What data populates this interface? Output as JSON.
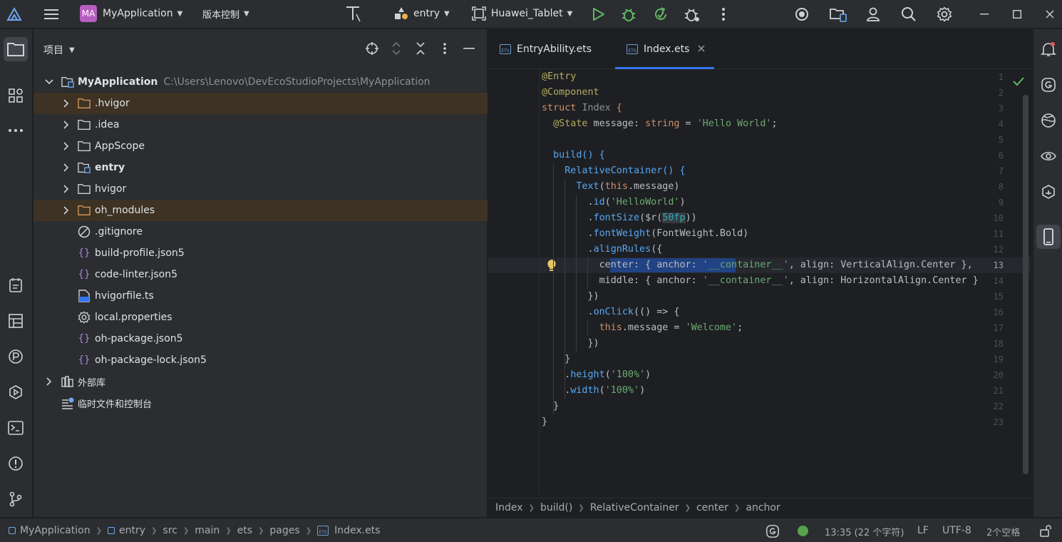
{
  "titlebar": {
    "project_badge": "MA",
    "project_name": "MyApplication",
    "vcs_label": "版本控制",
    "run_config": "entry",
    "device": "Huawei_Tablet"
  },
  "project_panel": {
    "title": "项目",
    "root_name": "MyApplication",
    "root_path": "C:\\Users\\Lenovo\\DevEcoStudioProjects\\MyApplication",
    "items": [
      {
        "label": ".hvigor",
        "kind": "folder-excluded"
      },
      {
        "label": ".idea",
        "kind": "folder"
      },
      {
        "label": "AppScope",
        "kind": "folder"
      },
      {
        "label": "entry",
        "kind": "module"
      },
      {
        "label": "hvigor",
        "kind": "folder"
      },
      {
        "label": "oh_modules",
        "kind": "folder-excluded"
      },
      {
        "label": ".gitignore",
        "kind": "ignore"
      },
      {
        "label": "build-profile.json5",
        "kind": "json"
      },
      {
        "label": "code-linter.json5",
        "kind": "json"
      },
      {
        "label": "hvigorfile.ts",
        "kind": "ts"
      },
      {
        "label": "local.properties",
        "kind": "properties"
      },
      {
        "label": "oh-package.json5",
        "kind": "json"
      },
      {
        "label": "oh-package-lock.json5",
        "kind": "json"
      }
    ],
    "external_libs": "外部库",
    "scratches": "临时文件和控制台"
  },
  "editor": {
    "tabs": [
      {
        "label": "EntryAbility.ets",
        "active": false
      },
      {
        "label": "Index.ets",
        "active": true
      }
    ],
    "file_icon_text": "ETS",
    "line_numbers": [
      "1",
      "2",
      "3",
      "4",
      "5",
      "6",
      "7",
      "8",
      "9",
      "10",
      "11",
      "12",
      "13",
      "14",
      "15",
      "16",
      "17",
      "18",
      "19",
      "20",
      "21",
      "22",
      "23"
    ],
    "current_line": "13",
    "code": {
      "l1": "@Entry",
      "l2": "@Component",
      "l3_kw": "struct",
      "l3_name": "Index",
      "l3_brace": " {",
      "l4_ann": "@State",
      "l4_name": " message: ",
      "l4_type": "string",
      "l4_eq": " = ",
      "l4_str": "'Hello World'",
      "l4_end": ";",
      "l6": "build() {",
      "l7": "RelativeContainer() {",
      "l8_fn": "Text",
      "l8_a": "(",
      "l8_this": "this",
      "l8_b": ".message)",
      "l9_a": ".",
      "l9_fn": "id",
      "l9_b": "(",
      "l9_str": "'HelloWorld'",
      "l9_c": ")",
      "l10_a": ".",
      "l10_fn": "fontSize",
      "l10_b": "($r(",
      "l10_res": "50fp",
      "l10_c": "))",
      "l11_a": ".",
      "l11_fn": "fontWeight",
      "l11_b": "(FontWeight.Bold)",
      "l12_a": ".",
      "l12_fn": "alignRules",
      "l12_b": "({",
      "l13_a": "center: { anchor: ",
      "l13_str": "'__container__'",
      "l13_b": ", align: VerticalAlign.Center },",
      "l14_a": "middle: { anchor: ",
      "l14_str": "'__container__'",
      "l14_b": ", align: HorizontalAlign.Center }",
      "l15": "})",
      "l16_a": ".",
      "l16_fn": "onClick",
      "l16_b": "(() => {",
      "l17_this": "this",
      "l17_a": ".message = ",
      "l17_str": "'Welcome'",
      "l17_b": ";",
      "l18": "})",
      "l19": "}",
      "l20_a": ".",
      "l20_fn": "height",
      "l20_b": "(",
      "l20_str": "'100%'",
      "l20_c": ")",
      "l21_a": ".",
      "l21_fn": "width",
      "l21_b": "(",
      "l21_str": "'100%'",
      "l21_c": ")",
      "l22": "}",
      "l23": "}"
    },
    "breadcrumbs": [
      "Index",
      "build()",
      "RelativeContainer",
      "center",
      "anchor"
    ]
  },
  "statusbar": {
    "path": [
      "MyApplication",
      "entry",
      "src",
      "main",
      "ets",
      "pages",
      "Index.ets"
    ],
    "position": "13:35 (22 个字符)",
    "line_sep": "LF",
    "encoding": "UTF-8",
    "indent": "2个空格"
  },
  "colors": {
    "accent": "#3574f0",
    "badge": "#b75dc0",
    "run": "#5fb865",
    "status_ok": "#56a34b"
  }
}
